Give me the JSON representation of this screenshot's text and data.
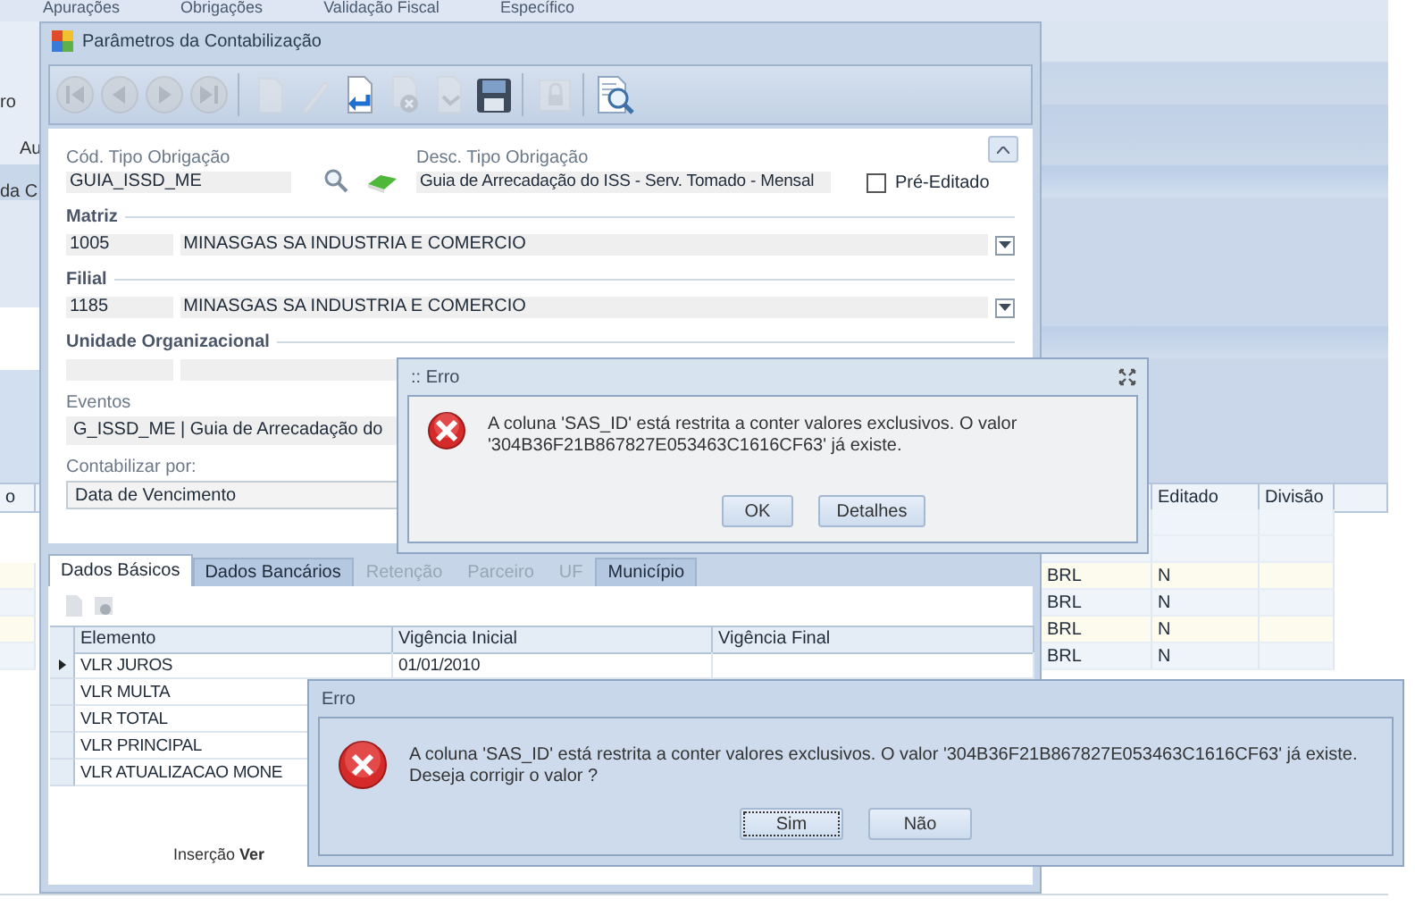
{
  "background_app": {
    "menu": [
      "Apurações",
      "Obrigações",
      "Validação Fiscal",
      "Específico"
    ],
    "side_texts": [
      "ro",
      "Au",
      "da C"
    ],
    "grid": {
      "column_1": "o",
      "editado_header": "Editado",
      "divisao_header": "Divisão",
      "rows": [
        {
          "column_3": "BRL",
          "editado": "N"
        },
        {
          "column_3": "BRL",
          "editado": "N"
        },
        {
          "column_3": "BRL",
          "editado": "N"
        },
        {
          "column_3": "BRL",
          "editado": "N"
        }
      ]
    }
  },
  "window": {
    "title": "Parâmetros da Contabilização",
    "toolbar": [
      {
        "kind": "first",
        "disabled": true
      },
      {
        "kind": "previous",
        "disabled": true
      },
      {
        "kind": "next",
        "disabled": true
      },
      {
        "kind": "last",
        "disabled": true
      },
      {
        "kind": "new",
        "disabled": true
      },
      {
        "kind": "edit",
        "disabled": true
      },
      {
        "kind": "undo",
        "disabled": false
      },
      {
        "kind": "delete",
        "disabled": true
      },
      {
        "kind": "forward",
        "disabled": true
      },
      {
        "kind": "save",
        "disabled": false
      },
      {
        "kind": "lock",
        "disabled": true
      },
      {
        "kind": "preview",
        "disabled": false
      }
    ],
    "form": {
      "cod_label": "Cód. Tipo Obrigação",
      "cod_value": "GUIA_ISSD_ME",
      "desc_label": "Desc. Tipo Obrigação",
      "desc_value": "Guia de Arrecadação do ISS - Serv. Tomado - Mensal",
      "pre_editado": {
        "label": "Pré-Editado",
        "checked": false
      },
      "matriz": {
        "title": "Matriz",
        "code": "1005",
        "name": "MINASGAS SA INDUSTRIA E COMERCIO"
      },
      "filial": {
        "title": "Filial",
        "code": "1185",
        "name": "MINASGAS SA INDUSTRIA E COMERCIO"
      },
      "unidade": {
        "title": "Unidade Organizacional"
      },
      "eventos": {
        "label": "Eventos",
        "value": "G_ISSD_ME | Guia de Arrecadação do"
      },
      "contabilizar": {
        "label": "Contabilizar por:",
        "value": "Data de Vencimento"
      }
    },
    "tabs": [
      {
        "label": "Dados Básicos",
        "selected": true,
        "disabled": false
      },
      {
        "label": "Dados Bancários",
        "selected": false,
        "disabled": false
      },
      {
        "label": "Retenção",
        "selected": false,
        "disabled": true
      },
      {
        "label": "Parceiro",
        "selected": false,
        "disabled": true
      },
      {
        "label": "UF",
        "selected": false,
        "disabled": true
      },
      {
        "label": "Município",
        "selected": false,
        "disabled": false
      }
    ],
    "grid": {
      "columns": [
        "Elemento",
        "Vigência Inicial",
        "Vigência Final"
      ],
      "rows": [
        {
          "elemento": "VLR JUROS",
          "vigencia_inicial": "01/01/2010",
          "current": true
        },
        {
          "elemento": "VLR MULTA",
          "current": false
        },
        {
          "elemento": "VLR TOTAL",
          "current": false
        },
        {
          "elemento": "VLR PRINCIPAL",
          "current": false
        },
        {
          "elemento": "VLR ATUALIZACAO MONE",
          "current": false
        }
      ]
    },
    "footer": "Inserção **Ver**"
  },
  "dialogs": [
    {
      "title": ":: Erro",
      "message": "A coluna 'SAS_ID' está restrita a conter valores exclusivos. O valor '304B36F21B867827E053463C1616CF63' já existe.",
      "buttons": [
        {
          "label": "OK",
          "focused": false
        },
        {
          "label": "Detalhes",
          "focused": false
        }
      ],
      "closable": true
    },
    {
      "title": "Erro",
      "message": "A coluna 'SAS_ID' está restrita a conter valores exclusivos. O valor '304B36F21B867827E053463C1616CF63' já existe. Deseja corrigir o valor ?",
      "buttons": [
        {
          "label": "Sim",
          "focused": true
        },
        {
          "label": "Não",
          "focused": false
        }
      ],
      "closable": false
    }
  ]
}
